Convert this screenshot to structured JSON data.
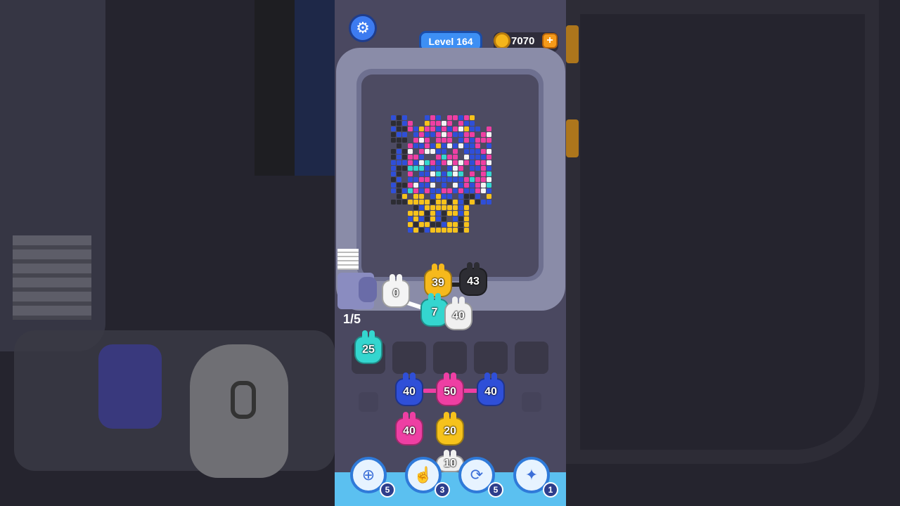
{
  "header": {
    "level_label": "Level 164",
    "coins": "7070",
    "plus_symbol": "+"
  },
  "conveyor": {
    "fraction": "1/5"
  },
  "belt_creatures": [
    {
      "value": "0",
      "color": "#f4f4f4"
    },
    {
      "value": "39",
      "color": "#f6b91c"
    },
    {
      "value": "43",
      "color": "#2d2d33"
    },
    {
      "value": "7",
      "color": "#34d6cf"
    },
    {
      "value": "40",
      "color": "#f0f0f0"
    }
  ],
  "holding_slots": [
    {
      "value": "25",
      "color": "#34d6cf"
    }
  ],
  "grid_creatures": [
    {
      "value": "40",
      "color": "#2f4fd8"
    },
    {
      "value": "50",
      "color": "#ee3fa3"
    },
    {
      "value": "40",
      "color": "#2f4fd8"
    },
    {
      "value": "40",
      "color": "#ee3fa3"
    },
    {
      "value": "20",
      "color": "#f6c21c"
    },
    {
      "value": "10",
      "color": "#f0f0f0"
    }
  ],
  "boosters": [
    {
      "name": "add-slot",
      "count": "5"
    },
    {
      "name": "pick",
      "count": "3"
    },
    {
      "name": "shuffle",
      "count": "5"
    },
    {
      "name": "magnet",
      "count": "1"
    }
  ],
  "colors": {
    "pink": "#ee3fa3",
    "blue": "#2f4fd8",
    "yellow": "#f6c21c",
    "cyan": "#34d6cf",
    "black": "#2d2d33",
    "white": "#f4f4f4"
  }
}
